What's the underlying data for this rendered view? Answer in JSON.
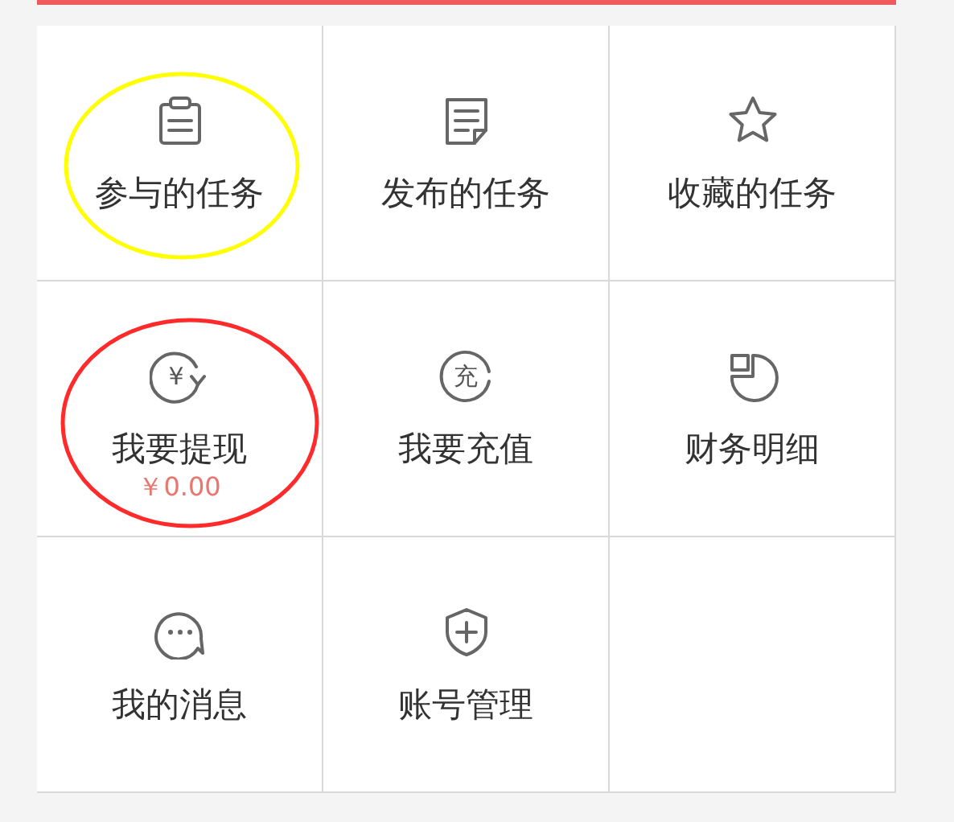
{
  "menu": [
    {
      "kind": "clipboard",
      "label": "参与的任务",
      "color": "#ffff00"
    },
    {
      "kind": "document",
      "label": "发布的任务"
    },
    {
      "kind": "star",
      "label": "收藏的任务"
    },
    {
      "kind": "coin-arrow",
      "icon_text": "¥",
      "label": "我要提现",
      "amount": "￥0.00",
      "color": "#ff2a2a"
    },
    {
      "kind": "coin",
      "icon_text": "充",
      "label": "我要充值"
    },
    {
      "kind": "pie",
      "label": "财务明细"
    },
    {
      "kind": "chat",
      "label": "我的消息"
    },
    {
      "kind": "shield",
      "label": "账号管理"
    },
    {
      "kind": "empty"
    }
  ]
}
